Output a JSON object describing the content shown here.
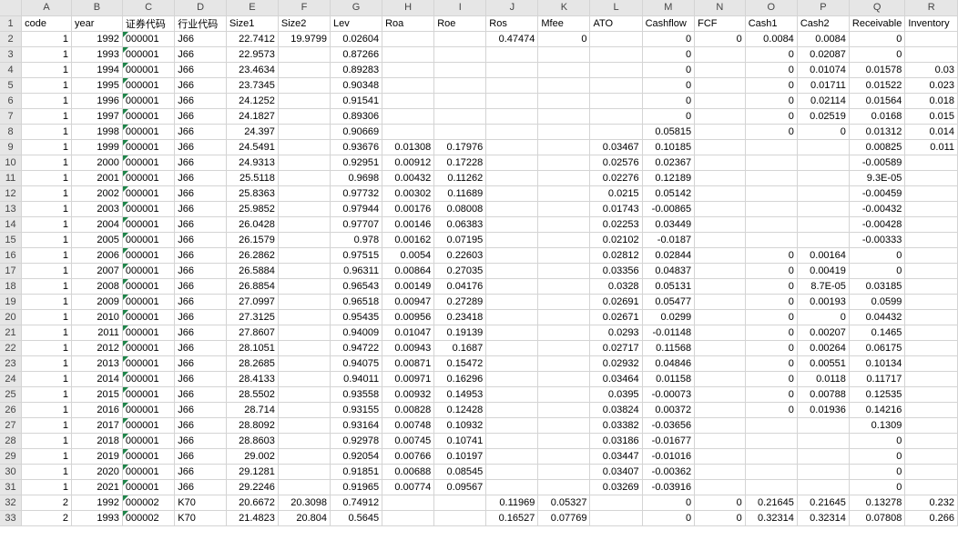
{
  "columns": [
    "A",
    "B",
    "C",
    "D",
    "E",
    "F",
    "G",
    "H",
    "I",
    "J",
    "K",
    "L",
    "M",
    "N",
    "O",
    "P",
    "Q",
    "R"
  ],
  "rows": [
    {
      "n": "1",
      "c": [
        "code",
        "year",
        "证券代码",
        "行业代码",
        "Size1",
        "Size2",
        "Lev",
        "Roa",
        "Roe",
        "Ros",
        "Mfee",
        "ATO",
        "Cashflow",
        "FCF",
        "Cash1",
        "Cash2",
        "Receivable",
        "Inventory"
      ]
    },
    {
      "n": "2",
      "c": [
        "1",
        "1992",
        "000001",
        "J66",
        "22.7412",
        "19.9799",
        "0.02604",
        "",
        "",
        "0.47474",
        "0",
        "",
        "0",
        "0",
        "0.0084",
        "0.0084",
        "0",
        ""
      ]
    },
    {
      "n": "3",
      "c": [
        "1",
        "1993",
        "000001",
        "J66",
        "22.9573",
        "",
        "0.87266",
        "",
        "",
        "",
        "",
        "",
        "0",
        "",
        "0",
        "0.02087",
        "0",
        ""
      ]
    },
    {
      "n": "4",
      "c": [
        "1",
        "1994",
        "000001",
        "J66",
        "23.4634",
        "",
        "0.89283",
        "",
        "",
        "",
        "",
        "",
        "0",
        "",
        "0",
        "0.01074",
        "0.01578",
        "0.03"
      ]
    },
    {
      "n": "5",
      "c": [
        "1",
        "1995",
        "000001",
        "J66",
        "23.7345",
        "",
        "0.90348",
        "",
        "",
        "",
        "",
        "",
        "0",
        "",
        "0",
        "0.01711",
        "0.01522",
        "0.023"
      ]
    },
    {
      "n": "6",
      "c": [
        "1",
        "1996",
        "000001",
        "J66",
        "24.1252",
        "",
        "0.91541",
        "",
        "",
        "",
        "",
        "",
        "0",
        "",
        "0",
        "0.02114",
        "0.01564",
        "0.018"
      ]
    },
    {
      "n": "7",
      "c": [
        "1",
        "1997",
        "000001",
        "J66",
        "24.1827",
        "",
        "0.89306",
        "",
        "",
        "",
        "",
        "",
        "0",
        "",
        "0",
        "0.02519",
        "0.0168",
        "0.015"
      ]
    },
    {
      "n": "8",
      "c": [
        "1",
        "1998",
        "000001",
        "J66",
        "24.397",
        "",
        "0.90669",
        "",
        "",
        "",
        "",
        "",
        "0.05815",
        "",
        "0",
        "0",
        "0.01312",
        "0.014"
      ]
    },
    {
      "n": "9",
      "c": [
        "1",
        "1999",
        "000001",
        "J66",
        "24.5491",
        "",
        "0.93676",
        "0.01308",
        "0.17976",
        "",
        "",
        "0.03467",
        "0.10185",
        "",
        "",
        "",
        "0.00825",
        "0.011"
      ]
    },
    {
      "n": "10",
      "c": [
        "1",
        "2000",
        "000001",
        "J66",
        "24.9313",
        "",
        "0.92951",
        "0.00912",
        "0.17228",
        "",
        "",
        "0.02576",
        "0.02367",
        "",
        "",
        "",
        "-0.00589",
        ""
      ]
    },
    {
      "n": "11",
      "c": [
        "1",
        "2001",
        "000001",
        "J66",
        "25.5118",
        "",
        "0.9698",
        "0.00432",
        "0.11262",
        "",
        "",
        "0.02276",
        "0.12189",
        "",
        "",
        "",
        "9.3E-05",
        ""
      ]
    },
    {
      "n": "12",
      "c": [
        "1",
        "2002",
        "000001",
        "J66",
        "25.8363",
        "",
        "0.97732",
        "0.00302",
        "0.11689",
        "",
        "",
        "0.0215",
        "0.05142",
        "",
        "",
        "",
        "-0.00459",
        ""
      ]
    },
    {
      "n": "13",
      "c": [
        "1",
        "2003",
        "000001",
        "J66",
        "25.9852",
        "",
        "0.97944",
        "0.00176",
        "0.08008",
        "",
        "",
        "0.01743",
        "-0.00865",
        "",
        "",
        "",
        "-0.00432",
        ""
      ]
    },
    {
      "n": "14",
      "c": [
        "1",
        "2004",
        "000001",
        "J66",
        "26.0428",
        "",
        "0.97707",
        "0.00146",
        "0.06383",
        "",
        "",
        "0.02253",
        "0.03449",
        "",
        "",
        "",
        "-0.00428",
        ""
      ]
    },
    {
      "n": "15",
      "c": [
        "1",
        "2005",
        "000001",
        "J66",
        "26.1579",
        "",
        "0.978",
        "0.00162",
        "0.07195",
        "",
        "",
        "0.02102",
        "-0.0187",
        "",
        "",
        "",
        "-0.00333",
        ""
      ]
    },
    {
      "n": "16",
      "c": [
        "1",
        "2006",
        "000001",
        "J66",
        "26.2862",
        "",
        "0.97515",
        "0.0054",
        "0.22603",
        "",
        "",
        "0.02812",
        "0.02844",
        "",
        "0",
        "0.00164",
        "0",
        ""
      ]
    },
    {
      "n": "17",
      "c": [
        "1",
        "2007",
        "000001",
        "J66",
        "26.5884",
        "",
        "0.96311",
        "0.00864",
        "0.27035",
        "",
        "",
        "0.03356",
        "0.04837",
        "",
        "0",
        "0.00419",
        "0",
        ""
      ]
    },
    {
      "n": "18",
      "c": [
        "1",
        "2008",
        "000001",
        "J66",
        "26.8854",
        "",
        "0.96543",
        "0.00149",
        "0.04176",
        "",
        "",
        "0.0328",
        "0.05131",
        "",
        "0",
        "8.7E-05",
        "0.03185",
        ""
      ]
    },
    {
      "n": "19",
      "c": [
        "1",
        "2009",
        "000001",
        "J66",
        "27.0997",
        "",
        "0.96518",
        "0.00947",
        "0.27289",
        "",
        "",
        "0.02691",
        "0.05477",
        "",
        "0",
        "0.00193",
        "0.0599",
        ""
      ]
    },
    {
      "n": "20",
      "c": [
        "1",
        "2010",
        "000001",
        "J66",
        "27.3125",
        "",
        "0.95435",
        "0.00956",
        "0.23418",
        "",
        "",
        "0.02671",
        "0.0299",
        "",
        "0",
        "0",
        "0.04432",
        ""
      ]
    },
    {
      "n": "21",
      "c": [
        "1",
        "2011",
        "000001",
        "J66",
        "27.8607",
        "",
        "0.94009",
        "0.01047",
        "0.19139",
        "",
        "",
        "0.0293",
        "-0.01148",
        "",
        "0",
        "0.00207",
        "0.1465",
        ""
      ]
    },
    {
      "n": "22",
      "c": [
        "1",
        "2012",
        "000001",
        "J66",
        "28.1051",
        "",
        "0.94722",
        "0.00943",
        "0.1687",
        "",
        "",
        "0.02717",
        "0.11568",
        "",
        "0",
        "0.00264",
        "0.06175",
        ""
      ]
    },
    {
      "n": "23",
      "c": [
        "1",
        "2013",
        "000001",
        "J66",
        "28.2685",
        "",
        "0.94075",
        "0.00871",
        "0.15472",
        "",
        "",
        "0.02932",
        "0.04846",
        "",
        "0",
        "0.00551",
        "0.10134",
        ""
      ]
    },
    {
      "n": "24",
      "c": [
        "1",
        "2014",
        "000001",
        "J66",
        "28.4133",
        "",
        "0.94011",
        "0.00971",
        "0.16296",
        "",
        "",
        "0.03464",
        "0.01158",
        "",
        "0",
        "0.0118",
        "0.11717",
        ""
      ]
    },
    {
      "n": "25",
      "c": [
        "1",
        "2015",
        "000001",
        "J66",
        "28.5502",
        "",
        "0.93558",
        "0.00932",
        "0.14953",
        "",
        "",
        "0.0395",
        "-0.00073",
        "",
        "0",
        "0.00788",
        "0.12535",
        ""
      ]
    },
    {
      "n": "26",
      "c": [
        "1",
        "2016",
        "000001",
        "J66",
        "28.714",
        "",
        "0.93155",
        "0.00828",
        "0.12428",
        "",
        "",
        "0.03824",
        "0.00372",
        "",
        "0",
        "0.01936",
        "0.14216",
        ""
      ]
    },
    {
      "n": "27",
      "c": [
        "1",
        "2017",
        "000001",
        "J66",
        "28.8092",
        "",
        "0.93164",
        "0.00748",
        "0.10932",
        "",
        "",
        "0.03382",
        "-0.03656",
        "",
        "",
        "",
        "0.1309",
        ""
      ]
    },
    {
      "n": "28",
      "c": [
        "1",
        "2018",
        "000001",
        "J66",
        "28.8603",
        "",
        "0.92978",
        "0.00745",
        "0.10741",
        "",
        "",
        "0.03186",
        "-0.01677",
        "",
        "",
        "",
        "0",
        ""
      ]
    },
    {
      "n": "29",
      "c": [
        "1",
        "2019",
        "000001",
        "J66",
        "29.002",
        "",
        "0.92054",
        "0.00766",
        "0.10197",
        "",
        "",
        "0.03447",
        "-0.01016",
        "",
        "",
        "",
        "0",
        ""
      ]
    },
    {
      "n": "30",
      "c": [
        "1",
        "2020",
        "000001",
        "J66",
        "29.1281",
        "",
        "0.91851",
        "0.00688",
        "0.08545",
        "",
        "",
        "0.03407",
        "-0.00362",
        "",
        "",
        "",
        "0",
        ""
      ]
    },
    {
      "n": "31",
      "c": [
        "1",
        "2021",
        "000001",
        "J66",
        "29.2246",
        "",
        "0.91965",
        "0.00774",
        "0.09567",
        "",
        "",
        "0.03269",
        "-0.03916",
        "",
        "",
        "",
        "0",
        ""
      ]
    },
    {
      "n": "32",
      "c": [
        "2",
        "1992",
        "000002",
        "K70",
        "20.6672",
        "20.3098",
        "0.74912",
        "",
        "",
        "0.11969",
        "0.05327",
        "",
        "0",
        "0",
        "0.21645",
        "0.21645",
        "0.13278",
        "0.232"
      ]
    },
    {
      "n": "33",
      "c": [
        "2",
        "1993",
        "000002",
        "K70",
        "21.4823",
        "20.804",
        "0.5645",
        "",
        "",
        "0.16527",
        "0.07769",
        "",
        "0",
        "0",
        "0.32314",
        "0.32314",
        "0.07808",
        "0.266"
      ]
    }
  ]
}
